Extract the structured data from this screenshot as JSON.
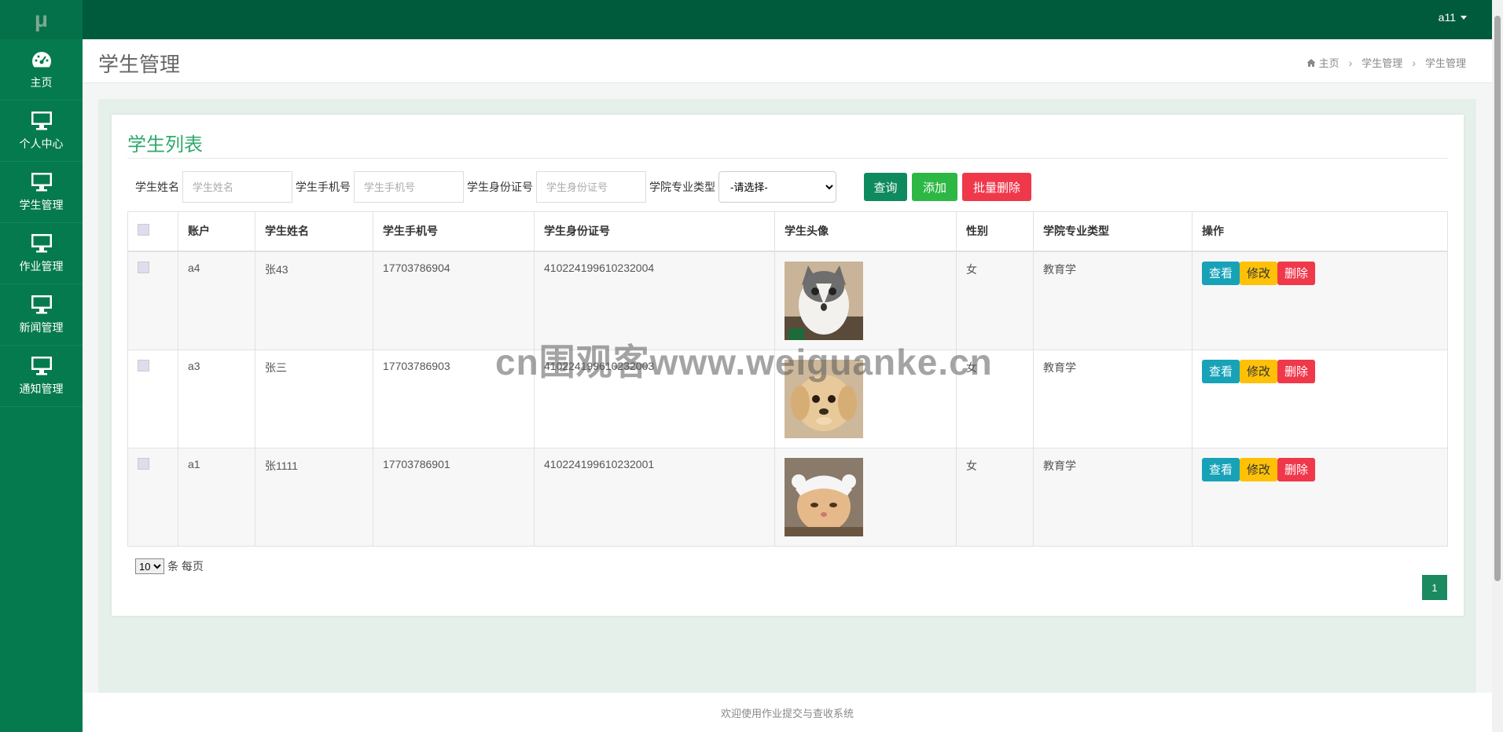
{
  "app": {
    "logo_text": "μ",
    "user": "a11"
  },
  "sidebar": {
    "items": [
      {
        "label": "主页",
        "icon": "dashboard-icon"
      },
      {
        "label": "个人中心",
        "icon": "monitor-icon"
      },
      {
        "label": "学生管理",
        "icon": "monitor-icon"
      },
      {
        "label": "作业管理",
        "icon": "monitor-icon"
      },
      {
        "label": "新闻管理",
        "icon": "monitor-icon"
      },
      {
        "label": "通知管理",
        "icon": "monitor-icon"
      }
    ]
  },
  "header": {
    "title": "学生管理",
    "breadcrumb": [
      "主页",
      "学生管理",
      "学生管理"
    ]
  },
  "card": {
    "title": "学生列表",
    "search": {
      "name_label": "学生姓名",
      "name_placeholder": "学生姓名",
      "phone_label": "学生手机号",
      "phone_placeholder": "学生手机号",
      "id_label": "学生身份证号",
      "id_placeholder": "学生身份证号",
      "major_label": "学院专业类型",
      "major_selected": "-请选择-"
    },
    "buttons": {
      "query": "查询",
      "add": "添加",
      "batch_delete": "批量删除"
    }
  },
  "table": {
    "columns": [
      "账户",
      "学生姓名",
      "学生手机号",
      "学生身份证号",
      "学生头像",
      "性别",
      "学院专业类型",
      "操作"
    ],
    "rows": [
      {
        "account": "a4",
        "name": "张43",
        "phone": "17703786904",
        "id_no": "410224199610232004",
        "avatar": "grey-white cat photo",
        "gender": "女",
        "major": "教育学"
      },
      {
        "account": "a3",
        "name": "张三",
        "phone": "17703786903",
        "id_no": "410224199610232003",
        "avatar": "puppy photo",
        "gender": "女",
        "major": "教育学"
      },
      {
        "account": "a1",
        "name": "张1111",
        "phone": "17703786901",
        "id_no": "410224199610232001",
        "avatar": "cat with hat photo",
        "gender": "女",
        "major": "教育学"
      }
    ],
    "actions": {
      "view": "查看",
      "edit": "修改",
      "delete": "删除"
    }
  },
  "pagination": {
    "page_size": "10",
    "page_size_suffix": "条 每页",
    "current_page": "1"
  },
  "footer": {
    "text": "欢迎使用作业提交与查收系统"
  },
  "watermark": "cn围观客www.weiguanke.cn",
  "colors": {
    "sidebar": "#057a4e",
    "topbar": "#005a3c",
    "accent": "#2eaa6c"
  }
}
